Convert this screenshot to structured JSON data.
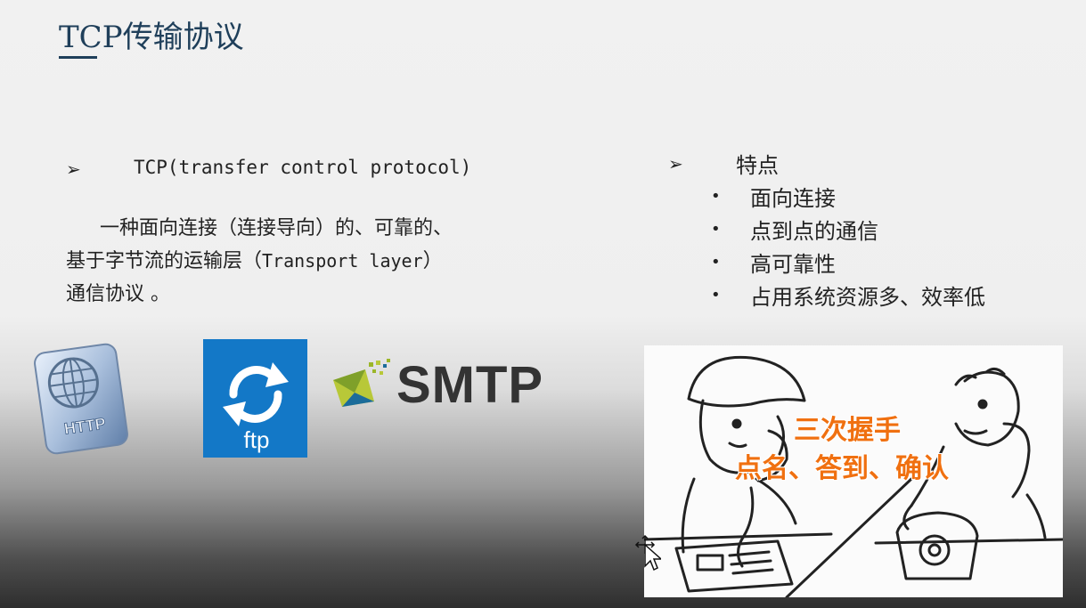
{
  "slide": {
    "title": "TCP传输协议"
  },
  "left_section": {
    "arrow": "➢",
    "heading": "TCP(transfer control protocol)",
    "description": {
      "line1": "一种面向连接（连接导向）的、可靠的、",
      "line2_prefix": "基于字节流的运输层（",
      "line2_mono": "Transport layer",
      "line2_suffix": "）",
      "line3": "通信协议 。"
    }
  },
  "right_section": {
    "arrow": "➢",
    "title": "特点",
    "bullet": "•",
    "features": [
      "面向连接",
      "点到点的通信",
      "高可靠性",
      "占用系统资源多、效率低"
    ]
  },
  "logos": {
    "http": "HTTP",
    "ftp": "ftp",
    "smtp": "SMTP"
  },
  "cartoon": {
    "caption_line1": "三次握手",
    "caption_line2": "点名、答到、确认"
  },
  "colors": {
    "title": "#1f3f5a",
    "ftp_blue": "#1378c7",
    "caption_orange": "#f07010"
  }
}
